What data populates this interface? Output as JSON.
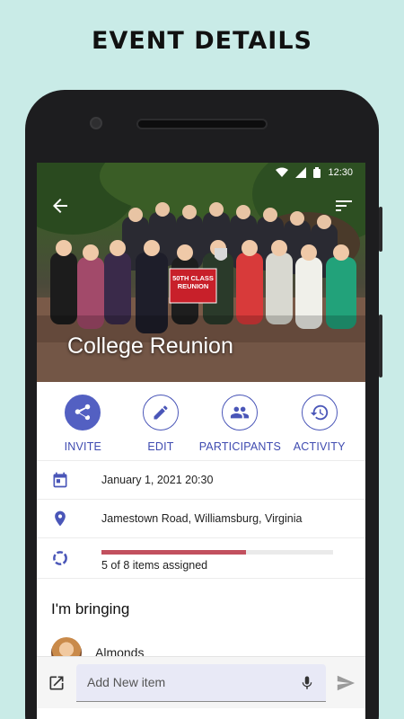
{
  "promo": {
    "title": "EVENT DETAILS"
  },
  "status_bar": {
    "time": "12:30"
  },
  "event": {
    "title": "College Reunion",
    "photo_banner": "50TH CLASS REUNION"
  },
  "actions": [
    {
      "label": "INVITE",
      "icon": "share-icon",
      "filled": true
    },
    {
      "label": "EDIT",
      "icon": "pencil-icon",
      "filled": false
    },
    {
      "label": "PARTICIPANTS",
      "icon": "people-icon",
      "filled": false
    },
    {
      "label": "ACTIVITY",
      "icon": "history-icon",
      "filled": false
    }
  ],
  "details": {
    "date": "January 1, 2021 20:30",
    "location": "Jamestown Road, Williamsburg, Virginia",
    "progress_text": "5 of 8 items assigned",
    "progress_fraction": 0.625
  },
  "bringing": {
    "section_title": "I'm bringing",
    "items": [
      {
        "name": "Almonds"
      }
    ]
  },
  "composer": {
    "placeholder": "Add New item"
  },
  "colors": {
    "accent": "#4a56b8",
    "progress": "#c2505e",
    "background": "#c9ebe7"
  }
}
